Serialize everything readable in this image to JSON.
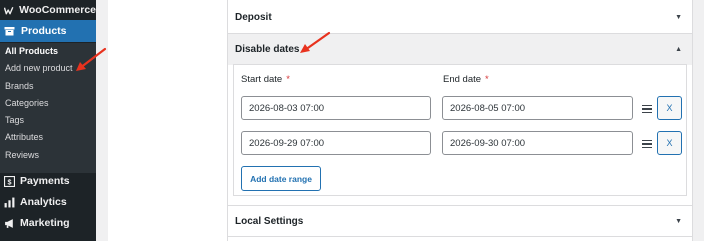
{
  "sidebar": {
    "woocommerce_label": "WooCommerce",
    "products_label": "Products",
    "submenu": [
      {
        "label": "All Products",
        "current": true
      },
      {
        "label": "Add new product",
        "current": false
      },
      {
        "label": "Brands",
        "current": false
      },
      {
        "label": "Categories",
        "current": false
      },
      {
        "label": "Tags",
        "current": false
      },
      {
        "label": "Attributes",
        "current": false
      },
      {
        "label": "Reviews",
        "current": false
      }
    ],
    "menu": [
      {
        "label": "Payments",
        "icon": "dollar-icon"
      },
      {
        "label": "Analytics",
        "icon": "bar-chart-icon"
      },
      {
        "label": "Marketing",
        "icon": "megaphone-icon"
      }
    ]
  },
  "panels": {
    "deposit": {
      "title": "Deposit",
      "caret": "▼"
    },
    "disable_dates": {
      "title": "Disable dates",
      "caret": "▲",
      "start_header": "Start date",
      "end_header": "End date",
      "required_mark": "*",
      "rows": [
        {
          "start": "2026-08-03 07:00",
          "end": "2026-08-05 07:00",
          "remove_label": "X"
        },
        {
          "start": "2026-09-29 07:00",
          "end": "2026-09-30 07:00",
          "remove_label": "X"
        }
      ],
      "add_button": "Add date range"
    },
    "local_settings": {
      "title": "Local Settings",
      "caret": "▼"
    }
  },
  "colors": {
    "sidebar_bg": "#1d2327",
    "submenu_bg": "#2c3338",
    "accent": "#2271b1",
    "required": "#d63638",
    "annotation_arrow": "#e8321e"
  }
}
